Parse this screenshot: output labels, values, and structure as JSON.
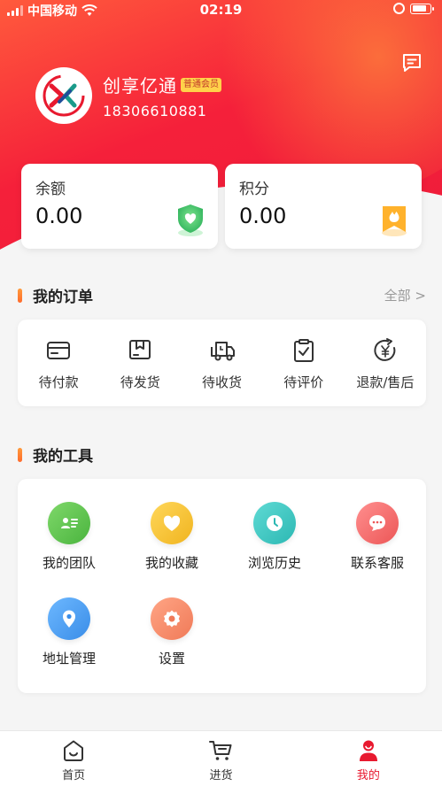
{
  "status_bar": {
    "carrier": "中国移动",
    "time": "02:19"
  },
  "profile": {
    "name": "创享亿通",
    "badge": "普通会员",
    "phone": "18306610881"
  },
  "balance_cards": [
    {
      "label": "余额",
      "value": "0.00",
      "icon": "shield-heart-icon",
      "color": "#3dbb6a"
    },
    {
      "label": "积分",
      "value": "0.00",
      "icon": "points-flame-icon",
      "color": "#ffb22c"
    }
  ],
  "orders": {
    "title": "我的订单",
    "view_all": "全部 >",
    "items": [
      {
        "label": "待付款",
        "icon": "wallet-icon"
      },
      {
        "label": "待发货",
        "icon": "package-icon"
      },
      {
        "label": "待收货",
        "icon": "truck-icon"
      },
      {
        "label": "待评价",
        "icon": "clipboard-check-icon"
      },
      {
        "label": "退款/售后",
        "icon": "refund-yen-icon"
      }
    ]
  },
  "tools": {
    "title": "我的工具",
    "items": [
      {
        "label": "我的团队",
        "icon": "team-card-icon",
        "color": "#5cc34d"
      },
      {
        "label": "我的收藏",
        "icon": "heart-icon",
        "color": "#f3c12f"
      },
      {
        "label": "浏览历史",
        "icon": "clock-icon",
        "color": "#3ec6c2"
      },
      {
        "label": "联系客服",
        "icon": "chat-bubble-icon",
        "color": "#f26b6b"
      },
      {
        "label": "地址管理",
        "icon": "location-pin-icon",
        "color": "#4c9ef0"
      },
      {
        "label": "设置",
        "icon": "gear-icon",
        "color": "#f58a6a"
      }
    ]
  },
  "tabbar": {
    "active": "我的",
    "items": [
      {
        "label": "首页",
        "icon": "home-icon"
      },
      {
        "label": "进货",
        "icon": "cart-icon"
      },
      {
        "label": "我的",
        "icon": "user-icon"
      }
    ]
  }
}
